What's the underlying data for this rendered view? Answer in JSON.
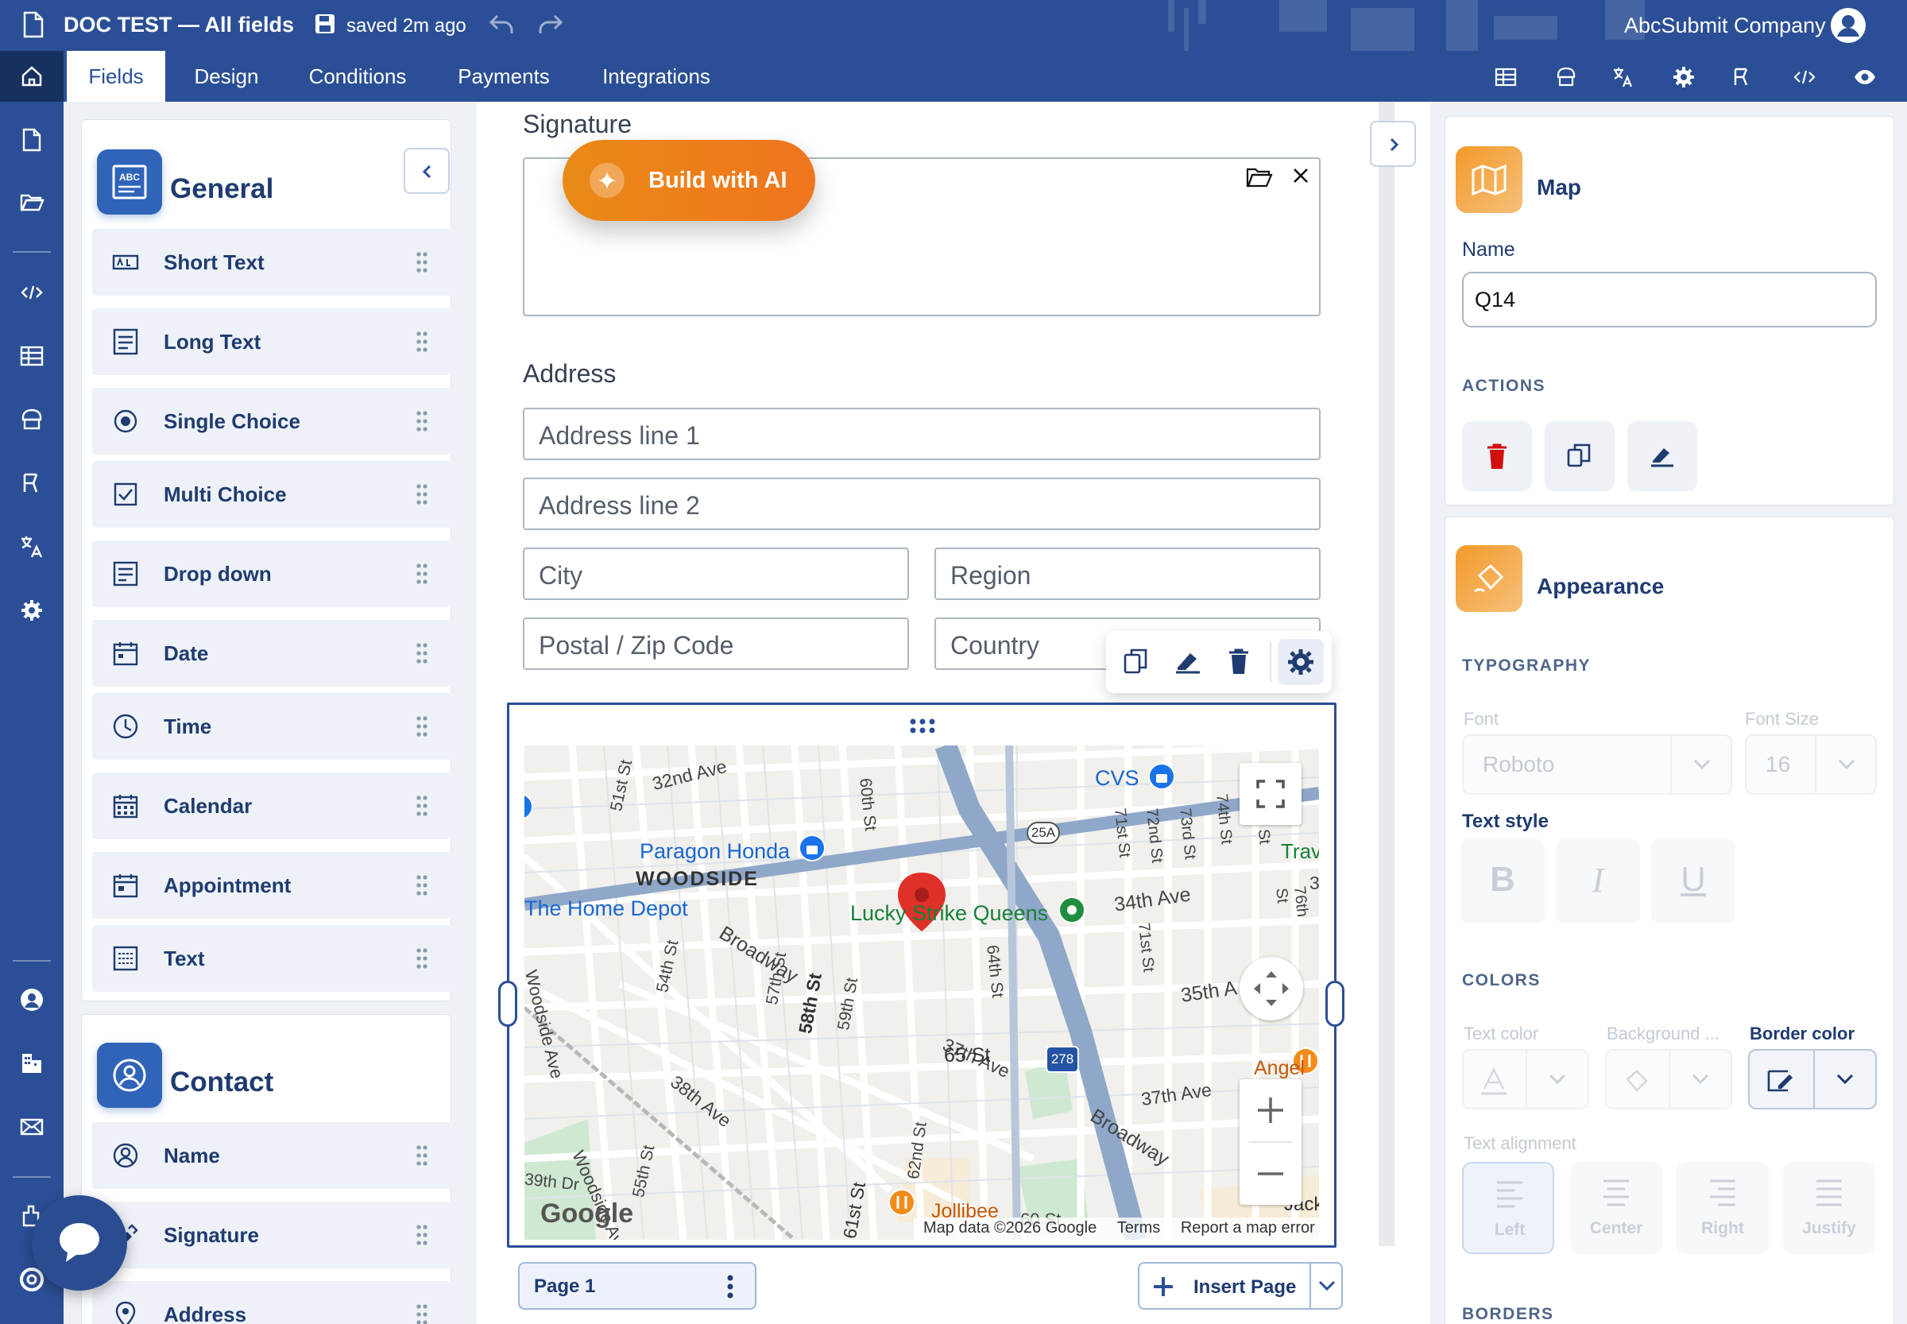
{
  "header": {
    "doc_title": "DOC TEST — All fields",
    "save_status": "saved 2m ago",
    "company": "AbcSubmit Company"
  },
  "tabs": [
    {
      "label": "Fields",
      "active": true
    },
    {
      "label": "Design",
      "active": false
    },
    {
      "label": "Conditions",
      "active": false
    },
    {
      "label": "Payments",
      "active": false
    },
    {
      "label": "Integrations",
      "active": false
    }
  ],
  "toolbar_icons": [
    "table-icon",
    "form-builder-icon",
    "translate-icon",
    "settings-icon",
    "workflow-icon",
    "code-icon",
    "preview-eye-icon"
  ],
  "palette": {
    "general": {
      "title": "General",
      "items": [
        {
          "label": "Short Text",
          "icon": "short-text-icon"
        },
        {
          "label": "Long Text",
          "icon": "long-text-icon"
        },
        {
          "label": "Single Choice",
          "icon": "radio-icon"
        },
        {
          "label": "Multi Choice",
          "icon": "checkbox-icon"
        },
        {
          "label": "Drop down",
          "icon": "dropdown-icon"
        },
        {
          "label": "Date",
          "icon": "date-icon"
        },
        {
          "label": "Time",
          "icon": "clock-icon"
        },
        {
          "label": "Calendar",
          "icon": "calendar-icon"
        },
        {
          "label": "Appointment",
          "icon": "appointment-icon"
        },
        {
          "label": "Text",
          "icon": "text-icon"
        }
      ]
    },
    "contact": {
      "title": "Contact",
      "items": [
        {
          "label": "Name",
          "icon": "person-icon"
        },
        {
          "label": "Signature",
          "icon": "signature-icon"
        },
        {
          "label": "Address",
          "icon": "location-pin-icon"
        }
      ]
    }
  },
  "canvas": {
    "build_ai_label": "Build with AI",
    "signature_label": "Signature",
    "address_label": "Address",
    "address_fields": {
      "line1": "Address line 1",
      "line2": "Address line 2",
      "city": "City",
      "region": "Region",
      "postal": "Postal / Zip Code",
      "country": "Country"
    },
    "map": {
      "labels": {
        "area": "WOODSIDE",
        "paragon": "Paragon Honda",
        "home_depot": "The Home Depot",
        "cvs": "CVS",
        "lucky": "Lucky Strike Queens",
        "broadway1": "Broadway",
        "broadway2": "Broadway",
        "ave34": "34th Ave",
        "ave35": "35th A",
        "ave37a": "37th Ave",
        "ave37b": "37th Ave",
        "ave38": "38th Ave",
        "ave32": "32nd Ave",
        "woodside_ave": "Woodside Ave",
        "woodside_ave2": "Woodside Ave",
        "st65": "65 St",
        "st51": "51st St",
        "st54": "54th St",
        "st55": "55th St",
        "st57": "57th St",
        "st58": "58th St",
        "st59": "59th St",
        "st60": "60th St",
        "st61": "61st St",
        "st62": "62nd St",
        "st64": "64th St",
        "st71a": "71st St",
        "st71b": "71st St",
        "st72": "72nd St",
        "st73": "73rd St",
        "st74": "74th St",
        "st75": "75th St",
        "st76": "76th St",
        "dr39": "39th Dr",
        "angel": "Angel",
        "jollibee": "Jollibee",
        "jack": "Jack",
        "trav": "Trav",
        "shield_25a": "25A",
        "shield_278": "278",
        "google": "Google",
        "attribution": "Map data ©2026 Google",
        "terms": "Terms",
        "report": "Report a map error",
        "road_2": "3",
        "road_3": "60 St"
      }
    },
    "page_label": "Page 1",
    "insert_page_label": "Insert Page"
  },
  "properties": {
    "title": "Map",
    "name_label": "Name",
    "name_value": "Q14",
    "actions_label": "ACTIONS",
    "appearance_title": "Appearance",
    "typography_label": "TYPOGRAPHY",
    "font_label": "Font",
    "font_size_label": "Font Size",
    "font_value": "Roboto",
    "font_size_value": "16",
    "text_style_label": "Text style",
    "bold_label": "B",
    "italic_label": "I",
    "underline_label": "U",
    "colors_label": "COLORS",
    "text_color_label": "Text color",
    "background_label": "Background ...",
    "border_color_label": "Border color",
    "text_alignment_label": "Text alignment",
    "align_left": "Left",
    "align_center": "Center",
    "align_right": "Right",
    "align_justify": "Justify",
    "borders_label": "BORDERS"
  },
  "colors": {
    "brand": "#2b4f96",
    "accent_orange": "#f0801c",
    "delete_red": "#d20f0f"
  }
}
